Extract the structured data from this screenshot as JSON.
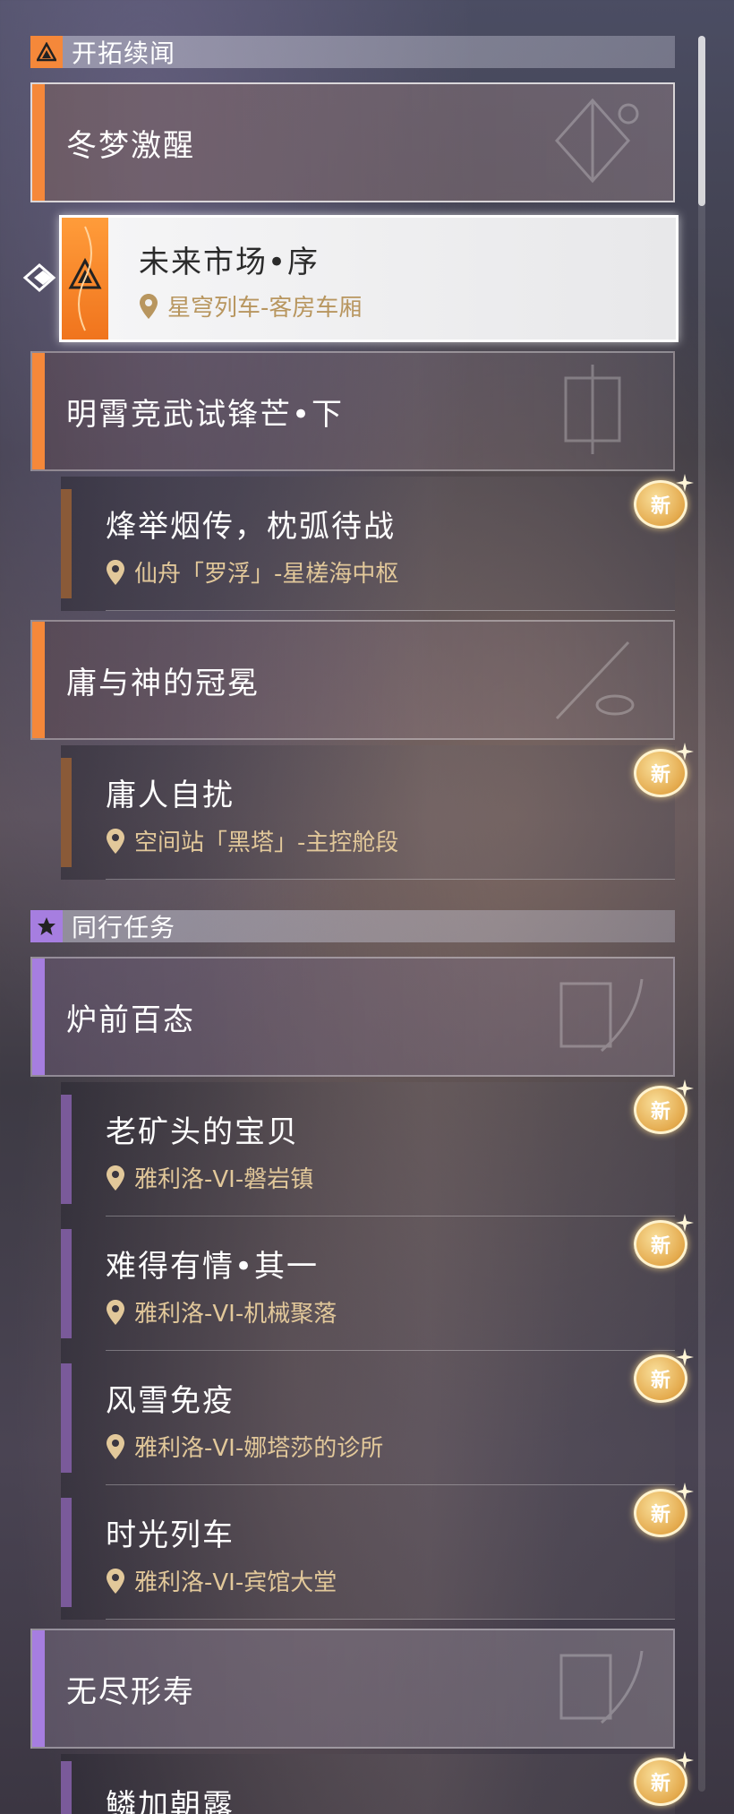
{
  "sections": {
    "trailblaze": {
      "title": "开拓续闻"
    },
    "companion": {
      "title": "同行任务"
    }
  },
  "chapters": [
    {
      "label": "冬梦激醒"
    },
    {
      "label": "明霄竞武试锋芒•下"
    },
    {
      "label": "庸与神的冠冕"
    },
    {
      "label": "炉前百态"
    },
    {
      "label": "无尽形寿"
    }
  ],
  "selected_quest": {
    "title": "未来市场•序",
    "location": "星穹列车-客房车厢"
  },
  "quests": [
    {
      "title": "烽举烟传，枕弧待战",
      "location": "仙舟「罗浮」-星槎海中枢"
    },
    {
      "title": "庸人自扰",
      "location": "空间站「黑塔」-主控舱段"
    },
    {
      "title": "老矿头的宝贝",
      "location": "雅利洛-VI-磐岩镇"
    },
    {
      "title": "难得有情•其一",
      "location": "雅利洛-VI-机械聚落"
    },
    {
      "title": "风雪免疫",
      "location": "雅利洛-VI-娜塔莎的诊所"
    },
    {
      "title": "时光列车",
      "location": "雅利洛-VI-宾馆大堂"
    },
    {
      "title": "鳞加朝露",
      "location": ""
    }
  ],
  "badge_label": "新",
  "colors": {
    "trailblaze_accent": "#f5883a",
    "companion_accent": "#a67ee0",
    "quest_bar_trailblaze": "#8a5a38",
    "quest_bar_companion": "#7a5a9a",
    "location_text": "#e2c89a"
  }
}
